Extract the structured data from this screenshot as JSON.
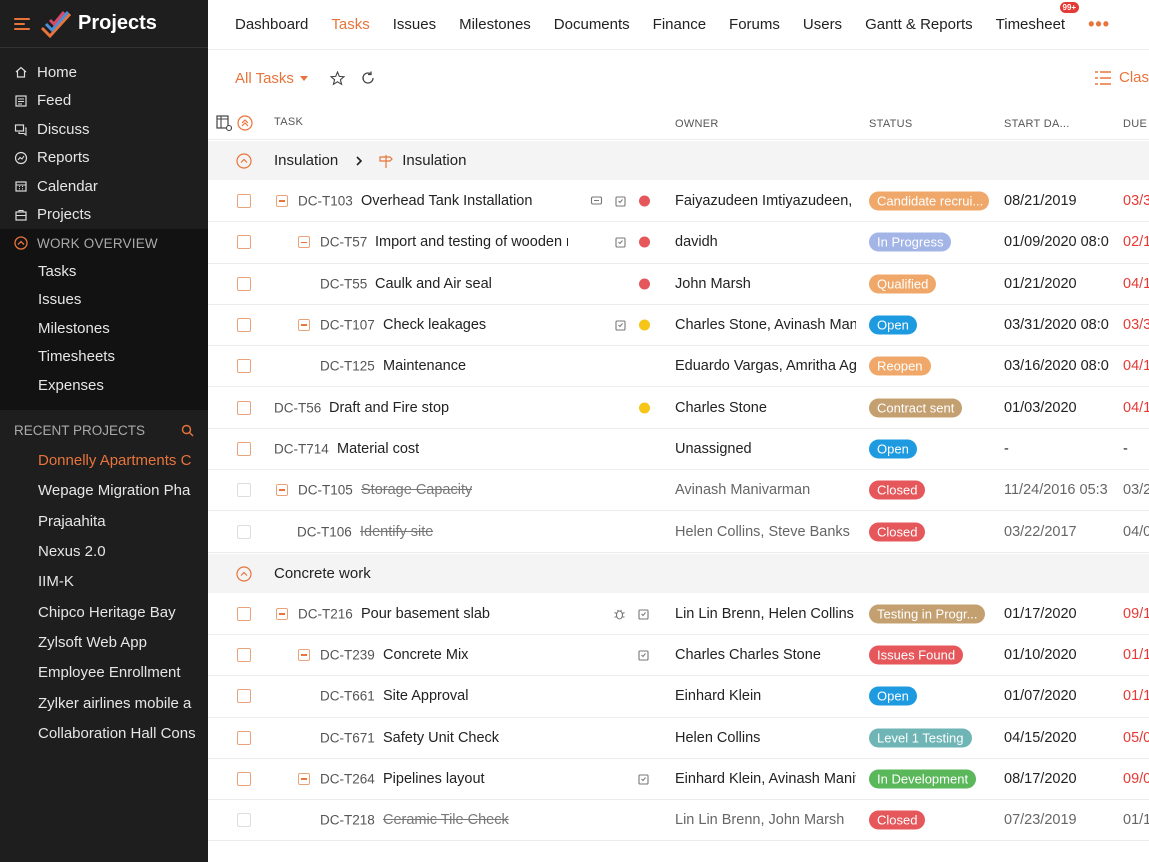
{
  "app": {
    "title": "Projects"
  },
  "sidebar": {
    "nav": [
      {
        "label": "Home",
        "icon": "home-icon"
      },
      {
        "label": "Feed",
        "icon": "feed-icon"
      },
      {
        "label": "Discuss",
        "icon": "discuss-icon"
      },
      {
        "label": "Reports",
        "icon": "reports-icon"
      },
      {
        "label": "Calendar",
        "icon": "calendar-icon"
      },
      {
        "label": "Projects",
        "icon": "projects-icon"
      }
    ],
    "work_overview": {
      "title": "WORK OVERVIEW",
      "items": [
        "Tasks",
        "Issues",
        "Milestones",
        "Timesheets",
        "Expenses"
      ]
    },
    "recent": {
      "title": "RECENT PROJECTS",
      "items": [
        "Donnelly Apartments C",
        "Wepage Migration Pha",
        "Prajaahita",
        "Nexus 2.0",
        "IIM-K",
        "Chipco Heritage Bay",
        "Zylsoft Web App",
        "Employee Enrollment",
        "Zylker airlines mobile a",
        "Collaboration Hall Cons"
      ]
    }
  },
  "topnav": {
    "tabs": [
      "Dashboard",
      "Tasks",
      "Issues",
      "Milestones",
      "Documents",
      "Finance",
      "Forums",
      "Users",
      "Gantt & Reports",
      "Timesheet"
    ],
    "active": "Tasks",
    "timesheet_badge": "99+",
    "more": "•••"
  },
  "toolbar": {
    "view_label": "All Tasks",
    "classic_label": "Clas"
  },
  "table": {
    "headers": {
      "task": "TASK",
      "owner": "OWNER",
      "status": "STATUS",
      "start": "START DA...",
      "due": "DUE"
    },
    "groups": [
      {
        "title": "Insulation",
        "subtitle": "Insulation",
        "rows": [
          {
            "id": "DC-T103",
            "name": "Overhead Tank Installation",
            "owner": "Faiyazudeen Imtiyazudeen, H",
            "status": "Candidate recrui...",
            "status_color": "#f0a86a",
            "start": "08/21/2019",
            "due": "03/3",
            "level": 1,
            "expand": true,
            "icons": [
              "comment-icon",
              "subtask-icon",
              "priority-high-icon"
            ],
            "closed": false
          },
          {
            "id": "DC-T57",
            "name": "Import and testing of wooden r",
            "owner": "davidh",
            "status": "In Progress",
            "status_color": "#a3b4e6",
            "start": "01/09/2020 08:0",
            "due": "02/1",
            "level": 2,
            "expand": true,
            "icons": [
              "subtask-icon",
              "priority-high-icon"
            ],
            "closed": false
          },
          {
            "id": "DC-T55",
            "name": "Caulk and Air seal",
            "owner": "John Marsh",
            "status": "Qualified",
            "status_color": "#f0a86a",
            "start": "01/21/2020",
            "due": "04/1",
            "level": 3,
            "expand": false,
            "icons": [
              "priority-high-icon"
            ],
            "closed": false
          },
          {
            "id": "DC-T107",
            "name": "Check leakages",
            "owner": "Charles Stone, Avinash Maniv",
            "status": "Open",
            "status_color": "#1e9be0",
            "start": "03/31/2020 08:0",
            "due": "03/3",
            "level": 2,
            "expand": true,
            "icons": [
              "subtask-icon",
              "priority-medium-icon"
            ],
            "closed": false
          },
          {
            "id": "DC-T125",
            "name": "Maintenance",
            "owner": "Eduardo Vargas, Amritha Agra",
            "status": "Reopen",
            "status_color": "#f0a86a",
            "start": "03/16/2020 08:0",
            "due": "04/1",
            "level": 3,
            "expand": false,
            "icons": [],
            "closed": false
          },
          {
            "id": "DC-T56",
            "name": "Draft and Fire stop",
            "owner": "Charles Stone",
            "status": "Contract sent",
            "status_color": "#c4a071",
            "start": "01/03/2020",
            "due": "04/1",
            "level": 0,
            "expand": false,
            "icons": [
              "priority-medium-icon"
            ],
            "closed": false
          },
          {
            "id": "DC-T714",
            "name": "Material cost",
            "owner": "Unassigned",
            "status": "Open",
            "status_color": "#1e9be0",
            "start": "-",
            "due": "-",
            "level": 0,
            "expand": false,
            "icons": [],
            "closed": false,
            "due_plain": true
          },
          {
            "id": "DC-T105",
            "name": "Storage Capacity",
            "owner": "Avinash Manivarman",
            "status": "Closed",
            "status_color": "#e5575b",
            "start": "11/24/2016 05:3",
            "due": "03/2",
            "level": 1,
            "expand": true,
            "icons": [],
            "closed": true
          },
          {
            "id": "DC-T106",
            "name": "Identify site",
            "owner": "Helen Collins, Steve Banks",
            "status": "Closed",
            "status_color": "#e5575b",
            "start": "03/22/2017",
            "due": "04/0",
            "level": 4,
            "expand": false,
            "icons": [],
            "closed": true
          }
        ]
      },
      {
        "title": "Concrete work",
        "subtitle": "",
        "rows": [
          {
            "id": "DC-T216",
            "name": "Pour basement slab",
            "owner": "Lin Lin Brenn, Helen Collins",
            "status": "Testing in Progr...",
            "status_color": "#c4a071",
            "start": "01/17/2020",
            "due": "09/1",
            "level": 1,
            "expand": true,
            "icons": [
              "bug-icon",
              "subtask-icon"
            ],
            "closed": false
          },
          {
            "id": "DC-T239",
            "name": "Concrete Mix",
            "owner": "Charles Charles Stone",
            "status": "Issues Found",
            "status_color": "#e5575b",
            "start": "01/10/2020",
            "due": "01/1",
            "level": 2,
            "expand": true,
            "icons": [
              "subtask-icon"
            ],
            "closed": false
          },
          {
            "id": "DC-T661",
            "name": "Site Approval",
            "owner": "Einhard Klein",
            "status": "Open",
            "status_color": "#1e9be0",
            "start": "01/07/2020",
            "due": "01/1",
            "level": 3,
            "expand": false,
            "icons": [],
            "closed": false
          },
          {
            "id": "DC-T671",
            "name": "Safety Unit Check",
            "owner": "Helen Collins",
            "status": "Level 1 Testing",
            "status_color": "#6fb5b5",
            "start": "04/15/2020",
            "due": "05/0",
            "level": 3,
            "expand": false,
            "icons": [],
            "closed": false
          },
          {
            "id": "DC-T264",
            "name": "Pipelines layout",
            "owner": "Einhard Klein, Avinash Maniv",
            "status": "In Development",
            "status_color": "#5ab75a",
            "start": "08/17/2020",
            "due": "09/0",
            "level": 2,
            "expand": true,
            "icons": [
              "subtask-icon"
            ],
            "closed": false
          },
          {
            "id": "DC-T218",
            "name": "Ceramic Tile Check",
            "owner": "Lin Lin Brenn, John Marsh",
            "status": "Closed",
            "status_color": "#e5575b",
            "start": "07/23/2019",
            "due": "01/1",
            "level": 3,
            "expand": false,
            "icons": [],
            "closed": true
          }
        ]
      }
    ]
  },
  "colors": {
    "accent": "#e8743b",
    "sidebar_bg": "#1e1e1e",
    "overdue": "#e53935"
  }
}
